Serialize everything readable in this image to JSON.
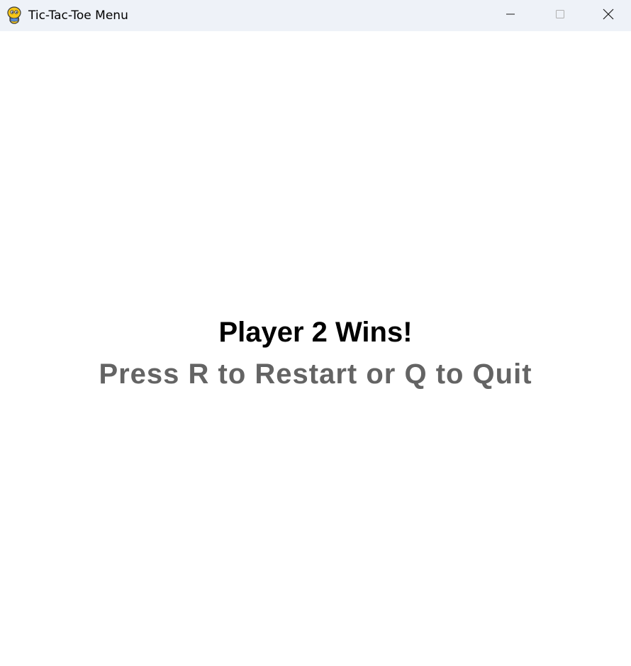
{
  "window": {
    "title": "Tic-Tac-Toe Menu",
    "icon": "pygame-snake-icon",
    "controls": {
      "minimize_icon": "minimize-icon",
      "maximize_icon": "maximize-icon",
      "close_icon": "close-icon"
    }
  },
  "game_over": {
    "headline": "Player 2 Wins!",
    "instructions": "Press R to Restart or Q to Quit"
  },
  "colors": {
    "titlebar_bg": "#eef2f8",
    "background": "#ffffff",
    "headline": "#000000",
    "instructions": "#646464"
  }
}
